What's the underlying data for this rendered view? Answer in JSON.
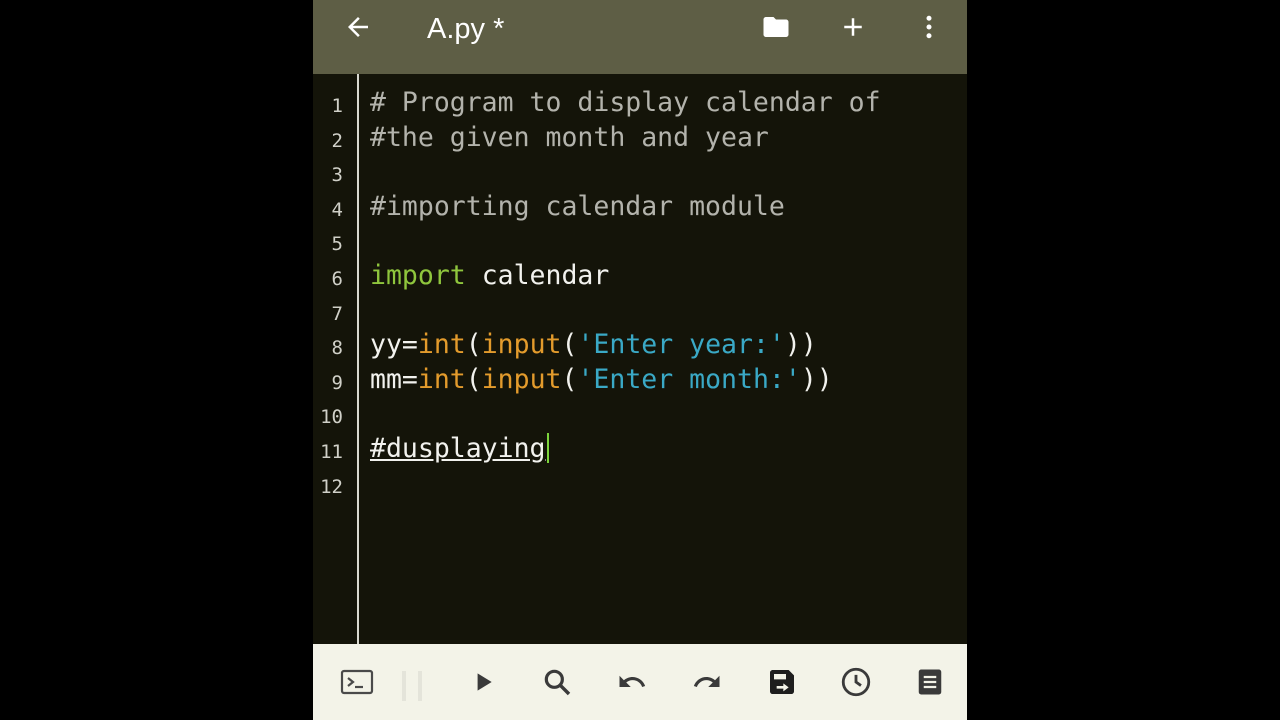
{
  "app_bar": {
    "title": "A.py *",
    "icons": {
      "back": "arrow-left-icon",
      "folder": "folder-icon",
      "add": "plus-icon",
      "more": "more-vertical-icon"
    }
  },
  "editor": {
    "line_numbers": [
      "1",
      "2",
      "3",
      "4",
      "5",
      "6",
      "7",
      "8",
      "9",
      "10",
      "11",
      "12"
    ],
    "lines": [
      [
        {
          "t": "# Program to display calendar of",
          "c": "cm"
        }
      ],
      [
        {
          "t": "#the given month and year",
          "c": "cm"
        }
      ],
      [],
      [
        {
          "t": "#importing calendar module",
          "c": "cm"
        }
      ],
      [],
      [
        {
          "t": "import",
          "c": "kw"
        },
        {
          "t": " calendar",
          "c": ""
        }
      ],
      [],
      [
        {
          "t": "yy=",
          "c": ""
        },
        {
          "t": "int",
          "c": "bi"
        },
        {
          "t": "(",
          "c": ""
        },
        {
          "t": "input",
          "c": "bi"
        },
        {
          "t": "(",
          "c": ""
        },
        {
          "t": "'Enter year:'",
          "c": "st"
        },
        {
          "t": "))",
          "c": ""
        }
      ],
      [
        {
          "t": "mm=",
          "c": ""
        },
        {
          "t": "int",
          "c": "bi"
        },
        {
          "t": "(",
          "c": ""
        },
        {
          "t": "input",
          "c": "bi"
        },
        {
          "t": "(",
          "c": ""
        },
        {
          "t": "'Enter month:'",
          "c": "st"
        },
        {
          "t": "))",
          "c": ""
        }
      ],
      [],
      [
        {
          "t": "#dusplaying",
          "c": "und"
        }
      ],
      []
    ],
    "colors": {
      "comment": "#b3b3ac",
      "keyword": "#8fc63d",
      "builtin": "#e39b2c",
      "string": "#3aa9c6",
      "caret": "#7cd43c"
    }
  },
  "bottom_bar": {
    "icons": [
      "terminal-icon",
      "run-icon",
      "search-icon",
      "undo-icon",
      "redo-icon",
      "save-icon",
      "history-icon",
      "document-icon"
    ]
  }
}
